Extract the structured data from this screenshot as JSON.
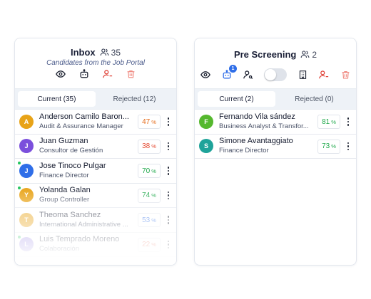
{
  "inbox": {
    "title": "Inbox",
    "count": "35",
    "subtitle": "Candidates from the Job Portal",
    "tabs": [
      {
        "label": "Current (35)"
      },
      {
        "label": "Rejected (12)"
      }
    ],
    "candidates": [
      {
        "initial": "A",
        "name": "Anderson Camilo Baron...",
        "role": "Audit & Assurance Manager",
        "score": "47",
        "unit": "%",
        "avatar_color": "#e8a317",
        "score_color": "#e56a17",
        "online": false
      },
      {
        "initial": "J",
        "name": "Juan Guzman",
        "role": "Consultor de Gestión",
        "score": "38",
        "unit": "%",
        "avatar_color": "#7b4fdc",
        "score_color": "#e5482f",
        "online": false
      },
      {
        "initial": "J",
        "name": "Jose Tinoco Pulgar",
        "role": "Finance Director",
        "score": "70",
        "unit": "%",
        "avatar_color": "#2f6ee8",
        "score_color": "#1ea84a",
        "online": true
      },
      {
        "initial": "Y",
        "name": "Yolanda Galan",
        "role": "Group Controller",
        "score": "74",
        "unit": "%",
        "avatar_color": "#e8a317",
        "score_color": "#1ea84a",
        "online": true
      },
      {
        "initial": "T",
        "name": "Theoma Sanchez",
        "role": "International Administrative ...",
        "score": "53",
        "unit": "%",
        "avatar_color": "#e8a317",
        "score_color": "#2f6ee8",
        "online": false
      },
      {
        "initial": "L",
        "name": "Luis Temprado Moreno",
        "role": "Colaboración",
        "score": "22",
        "unit": "%",
        "avatar_color": "#8e7be0",
        "score_color": "#e5482f",
        "online": true
      }
    ]
  },
  "pre": {
    "title": "Pre Screening",
    "count": "2",
    "bot_badge": "1",
    "tabs": [
      {
        "label": "Current (2)"
      },
      {
        "label": "Rejected (0)"
      }
    ],
    "candidates": [
      {
        "initial": "F",
        "name": "Fernando Vila sández",
        "role": "Business Analyst & Transfor...",
        "score": "81",
        "unit": "%",
        "avatar_color": "#55b82e",
        "score_color": "#1ea84a",
        "online": false
      },
      {
        "initial": "S",
        "name": "Simone Avantaggiato",
        "role": "Finance Director",
        "score": "73",
        "unit": "%",
        "avatar_color": "#1fa39a",
        "score_color": "#1ea84a",
        "online": false
      }
    ]
  },
  "icons": {
    "people": "people-icon",
    "eye": "eye-icon",
    "bot": "robot-icon",
    "person_key": "person-key-icon",
    "building": "building-icon",
    "person_remove": "person-remove-icon",
    "trash": "trash-icon"
  }
}
